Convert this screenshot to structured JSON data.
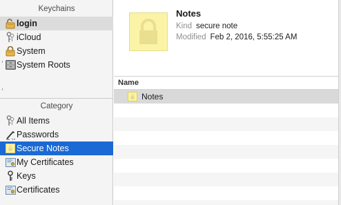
{
  "sidebar": {
    "keychains_header": "Keychains",
    "keychains": [
      {
        "label": "login",
        "icon": "lock-open-icon",
        "bold": true,
        "selected": true
      },
      {
        "label": "iCloud",
        "icon": "keys-icon"
      },
      {
        "label": "System",
        "icon": "lock-icon"
      },
      {
        "label": "System Roots",
        "icon": "cabinet-icon"
      }
    ],
    "category_header": "Category",
    "categories": [
      {
        "label": "All Items",
        "icon": "keys-icon"
      },
      {
        "label": "Passwords",
        "icon": "pen-icon"
      },
      {
        "label": "Secure Notes",
        "icon": "note-icon",
        "selected": true
      },
      {
        "label": "My Certificates",
        "icon": "certificate-icon"
      },
      {
        "label": "Keys",
        "icon": "key-icon"
      },
      {
        "label": "Certificates",
        "icon": "certificate-icon"
      }
    ]
  },
  "detail": {
    "title": "Notes",
    "kind_label": "Kind",
    "kind_value": "secure note",
    "modified_label": "Modified",
    "modified_value": "Feb 2, 2016, 5:55:25 AM"
  },
  "table": {
    "columns": [
      "Name"
    ],
    "rows": [
      {
        "name": "Notes",
        "icon": "note-icon",
        "selected": true
      }
    ]
  },
  "colors": {
    "selection_blue": "#1a69d4",
    "note_yellow": "#fbf3a5"
  }
}
